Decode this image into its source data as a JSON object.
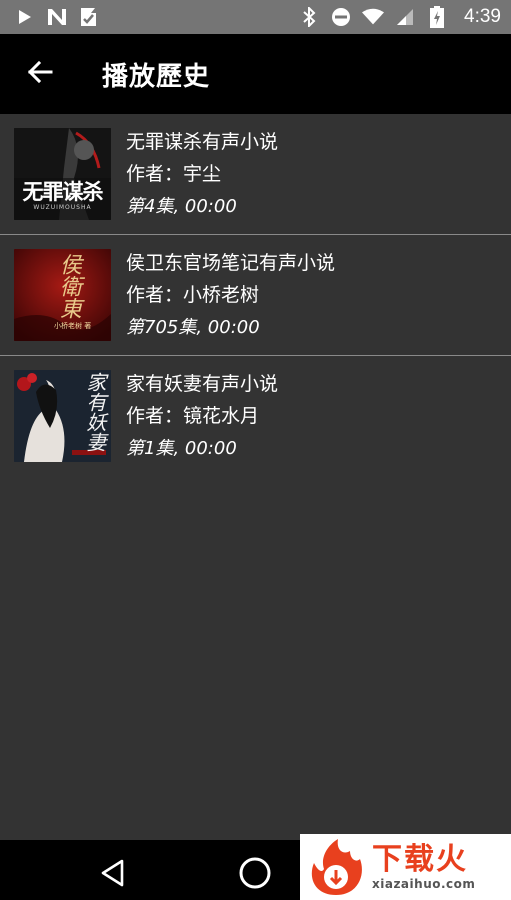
{
  "status_bar": {
    "time": "4:39",
    "left_icons": [
      "play-icon",
      "n-icon",
      "check-flag-icon"
    ],
    "right_icons": [
      "bluetooth-icon",
      "dnd-icon",
      "wifi-icon",
      "signal-icon",
      "battery-charging-icon"
    ]
  },
  "app_bar": {
    "title": "播放歷史",
    "back_icon": "arrow-left-icon"
  },
  "history": [
    {
      "title": "无罪谋杀有声小说",
      "author": "作者：宇尘",
      "episode": "第4集, 00:00",
      "cover_text": "无罪谋杀",
      "cover_sub": "WUZUIMOUSHA",
      "cover_color": "#1a1a1a"
    },
    {
      "title": "侯卫东官场笔记有声小说",
      "author": "作者：小桥老树",
      "episode": "第705集, 00:00",
      "cover_text": "侯衛東",
      "cover_sub": "小桥老树 著",
      "cover_color": "#7a1010"
    },
    {
      "title": "家有妖妻有声小说",
      "author": "作者：镜花水月",
      "episode": "第1集, 00:00",
      "cover_text": "家有妖妻",
      "cover_sub": "",
      "cover_color": "#1c2530"
    }
  ],
  "nav_bar": {
    "back_icon": "nav-back-triangle-icon",
    "home_icon": "nav-home-circle-icon"
  },
  "watermark": {
    "cn": "下载火",
    "en": "xiazaihuo.com"
  },
  "colors": {
    "background": "#333333",
    "app_bar": "#000000",
    "status_bar": "#757575",
    "divider": "#8a8a8a",
    "watermark_red": "#e8401e"
  }
}
